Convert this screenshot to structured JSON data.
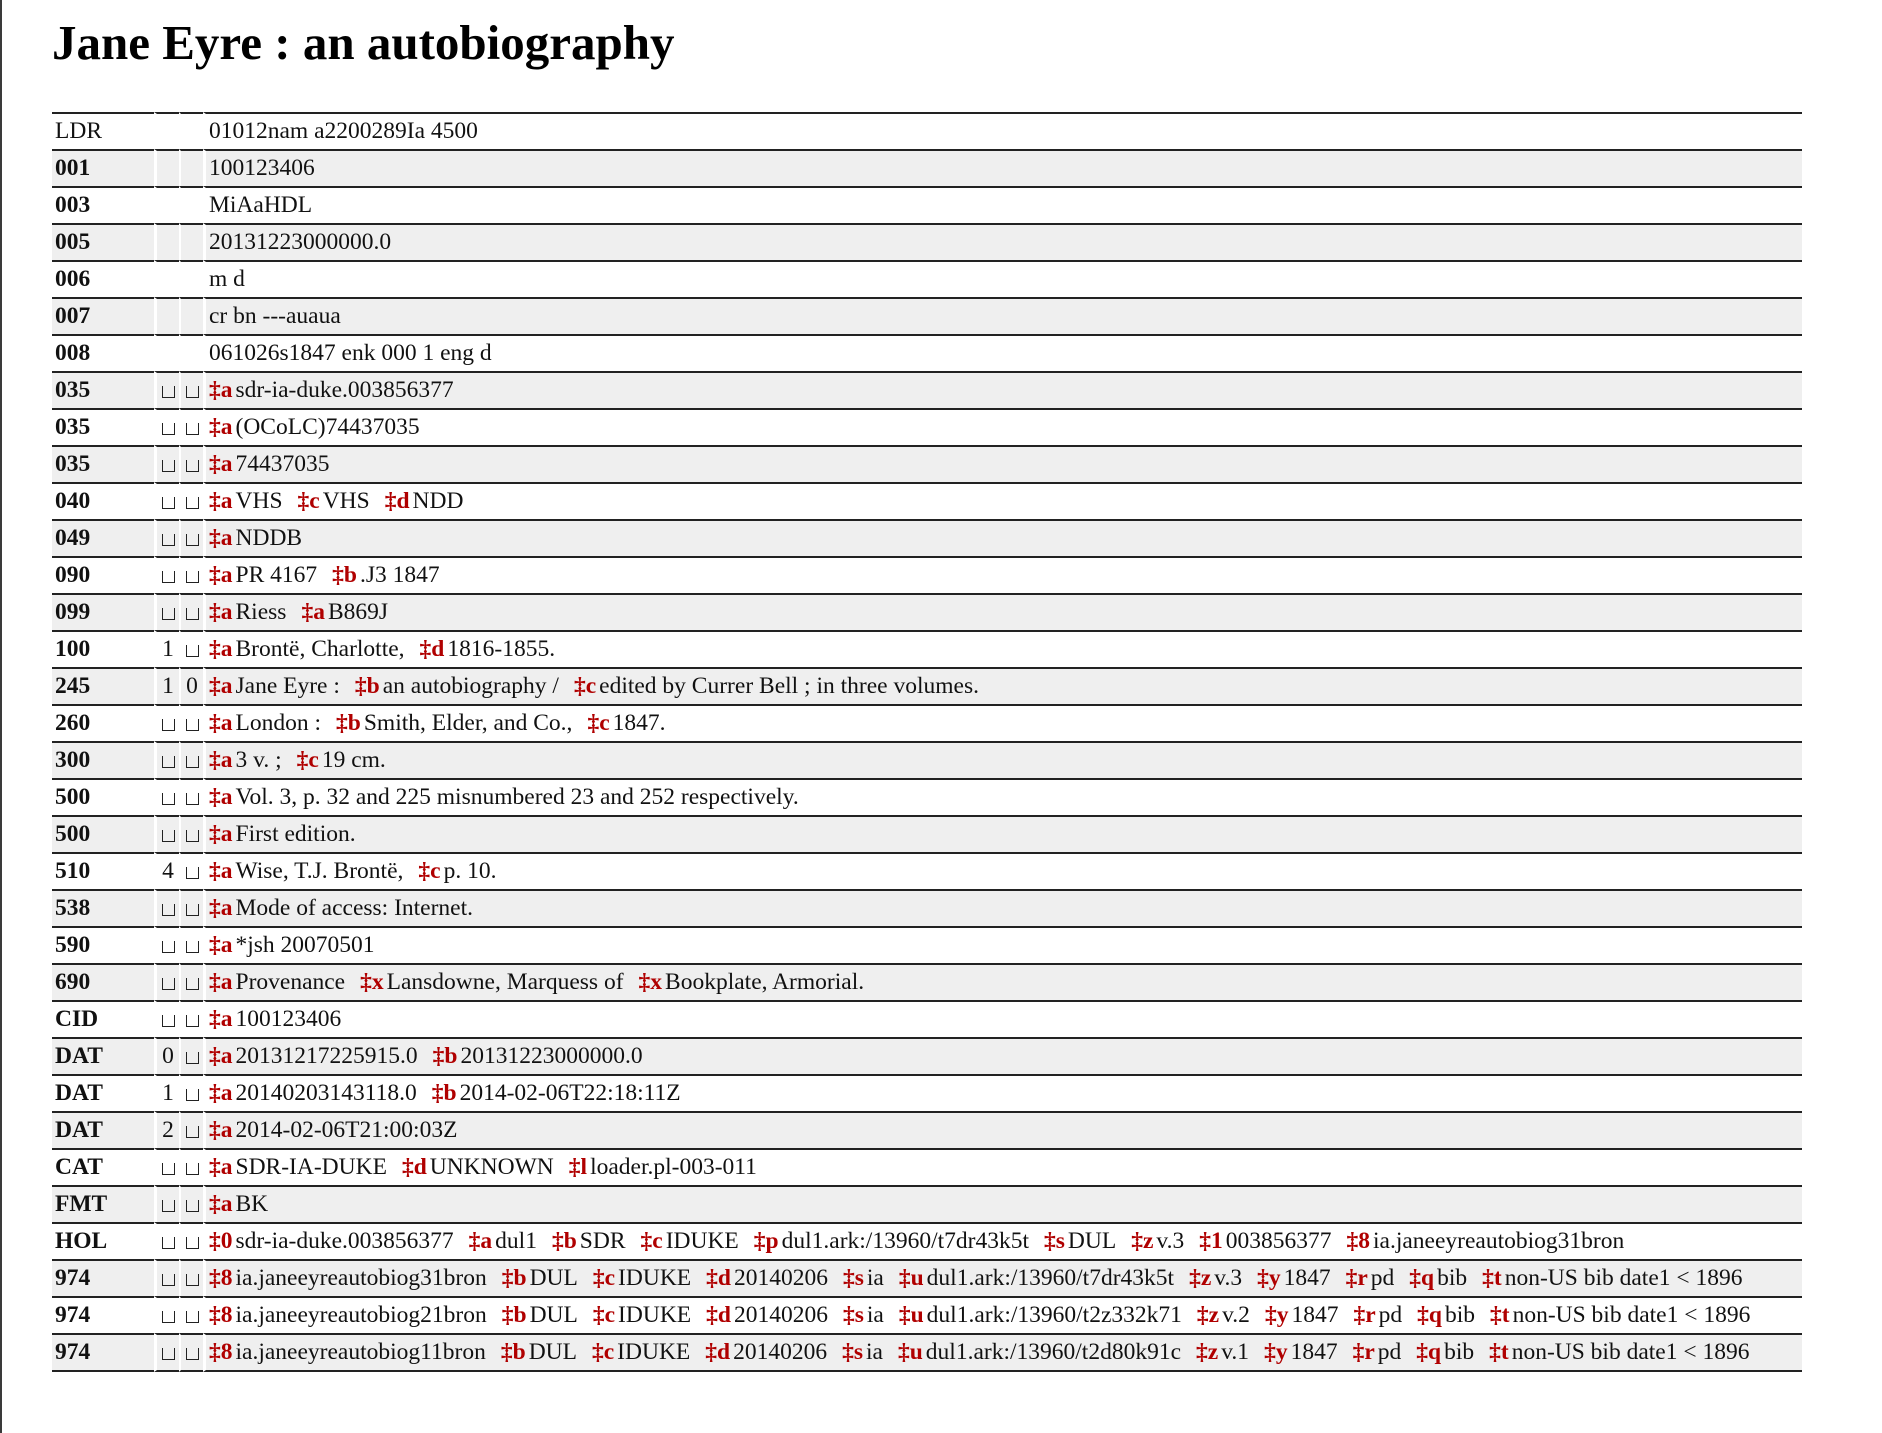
{
  "record": {
    "title": "Jane Eyre : an autobiography",
    "colors": {
      "subfield_code": "#b00000",
      "row_stripe": "#efefef",
      "rule": "#222222"
    },
    "icons": {
      "blank_indicator": "blank-indicator-icon"
    },
    "fields": [
      {
        "tag": "LDR",
        "value": "01012nam a2200289Ia 4500"
      },
      {
        "tag": "001",
        "value": "100123406"
      },
      {
        "tag": "003",
        "value": "MiAaHDL"
      },
      {
        "tag": "005",
        "value": "20131223000000.0"
      },
      {
        "tag": "006",
        "value": "m d"
      },
      {
        "tag": "007",
        "value": "cr bn ---auaua"
      },
      {
        "tag": "008",
        "value": "061026s1847 enk 000 1 eng d"
      },
      {
        "tag": "035",
        "ind1": "",
        "ind2": "",
        "subfields": [
          {
            "code": "‡a",
            "text": "sdr-ia-duke.003856377"
          }
        ]
      },
      {
        "tag": "035",
        "ind1": "",
        "ind2": "",
        "subfields": [
          {
            "code": "‡a",
            "text": "(OCoLC)74437035"
          }
        ]
      },
      {
        "tag": "035",
        "ind1": "",
        "ind2": "",
        "subfields": [
          {
            "code": "‡a",
            "text": "74437035"
          }
        ]
      },
      {
        "tag": "040",
        "ind1": "",
        "ind2": "",
        "subfields": [
          {
            "code": "‡a",
            "text": "VHS"
          },
          {
            "code": "‡c",
            "text": "VHS"
          },
          {
            "code": "‡d",
            "text": "NDD"
          }
        ]
      },
      {
        "tag": "049",
        "ind1": "",
        "ind2": "",
        "subfields": [
          {
            "code": "‡a",
            "text": "NDDB"
          }
        ]
      },
      {
        "tag": "090",
        "ind1": "",
        "ind2": "",
        "subfields": [
          {
            "code": "‡a",
            "text": "PR 4167"
          },
          {
            "code": "‡b",
            "text": ".J3 1847"
          }
        ]
      },
      {
        "tag": "099",
        "ind1": "",
        "ind2": "",
        "subfields": [
          {
            "code": "‡a",
            "text": "Riess"
          },
          {
            "code": "‡a",
            "text": "B869J"
          }
        ]
      },
      {
        "tag": "100",
        "ind1": "1",
        "ind2": "",
        "subfields": [
          {
            "code": "‡a",
            "text": "Brontë, Charlotte,"
          },
          {
            "code": "‡d",
            "text": "1816-1855."
          }
        ]
      },
      {
        "tag": "245",
        "ind1": "1",
        "ind2": "0",
        "subfields": [
          {
            "code": "‡a",
            "text": "Jane Eyre :"
          },
          {
            "code": "‡b",
            "text": "an autobiography /"
          },
          {
            "code": "‡c",
            "text": "edited by Currer Bell ; in three volumes."
          }
        ]
      },
      {
        "tag": "260",
        "ind1": "",
        "ind2": "",
        "subfields": [
          {
            "code": "‡a",
            "text": "London :"
          },
          {
            "code": "‡b",
            "text": "Smith, Elder, and Co.,"
          },
          {
            "code": "‡c",
            "text": "1847."
          }
        ]
      },
      {
        "tag": "300",
        "ind1": "",
        "ind2": "",
        "subfields": [
          {
            "code": "‡a",
            "text": "3 v. ;"
          },
          {
            "code": "‡c",
            "text": "19 cm."
          }
        ]
      },
      {
        "tag": "500",
        "ind1": "",
        "ind2": "",
        "subfields": [
          {
            "code": "‡a",
            "text": "Vol. 3, p. 32 and 225 misnumbered 23 and 252 respectively."
          }
        ]
      },
      {
        "tag": "500",
        "ind1": "",
        "ind2": "",
        "subfields": [
          {
            "code": "‡a",
            "text": "First edition."
          }
        ]
      },
      {
        "tag": "510",
        "ind1": "4",
        "ind2": "",
        "subfields": [
          {
            "code": "‡a",
            "text": "Wise, T.J. Brontë,"
          },
          {
            "code": "‡c",
            "text": "p. 10."
          }
        ]
      },
      {
        "tag": "538",
        "ind1": "",
        "ind2": "",
        "subfields": [
          {
            "code": "‡a",
            "text": "Mode of access: Internet."
          }
        ]
      },
      {
        "tag": "590",
        "ind1": "",
        "ind2": "",
        "subfields": [
          {
            "code": "‡a",
            "text": "*jsh 20070501"
          }
        ]
      },
      {
        "tag": "690",
        "ind1": "",
        "ind2": "",
        "subfields": [
          {
            "code": "‡a",
            "text": "Provenance"
          },
          {
            "code": "‡x",
            "text": "Lansdowne, Marquess of"
          },
          {
            "code": "‡x",
            "text": "Bookplate, Armorial."
          }
        ]
      },
      {
        "tag": "CID",
        "ind1": "",
        "ind2": "",
        "subfields": [
          {
            "code": "‡a",
            "text": "100123406"
          }
        ]
      },
      {
        "tag": "DAT",
        "ind1": "0",
        "ind2": "",
        "subfields": [
          {
            "code": "‡a",
            "text": "20131217225915.0"
          },
          {
            "code": "‡b",
            "text": "20131223000000.0"
          }
        ]
      },
      {
        "tag": "DAT",
        "ind1": "1",
        "ind2": "",
        "subfields": [
          {
            "code": "‡a",
            "text": "20140203143118.0"
          },
          {
            "code": "‡b",
            "text": "2014-02-06T22:18:11Z"
          }
        ]
      },
      {
        "tag": "DAT",
        "ind1": "2",
        "ind2": "",
        "subfields": [
          {
            "code": "‡a",
            "text": "2014-02-06T21:00:03Z"
          }
        ]
      },
      {
        "tag": "CAT",
        "ind1": "",
        "ind2": "",
        "subfields": [
          {
            "code": "‡a",
            "text": "SDR-IA-DUKE"
          },
          {
            "code": "‡d",
            "text": "UNKNOWN"
          },
          {
            "code": "‡l",
            "text": "loader.pl-003-011"
          }
        ]
      },
      {
        "tag": "FMT",
        "ind1": "",
        "ind2": "",
        "subfields": [
          {
            "code": "‡a",
            "text": "BK"
          }
        ]
      },
      {
        "tag": "HOL",
        "ind1": "",
        "ind2": "",
        "subfields": [
          {
            "code": "‡0",
            "text": "sdr-ia-duke.003856377"
          },
          {
            "code": "‡a",
            "text": "dul1"
          },
          {
            "code": "‡b",
            "text": "SDR"
          },
          {
            "code": "‡c",
            "text": "IDUKE"
          },
          {
            "code": "‡p",
            "text": "dul1.ark:/13960/t7dr43k5t"
          },
          {
            "code": "‡s",
            "text": "DUL"
          },
          {
            "code": "‡z",
            "text": "v.3"
          },
          {
            "code": "‡1",
            "text": "003856377"
          },
          {
            "code": "‡8",
            "text": "ia.janeeyreautobiog31bron"
          }
        ]
      },
      {
        "tag": "974",
        "ind1": "",
        "ind2": "",
        "subfields": [
          {
            "code": "‡8",
            "text": "ia.janeeyreautobiog31bron"
          },
          {
            "code": "‡b",
            "text": "DUL"
          },
          {
            "code": "‡c",
            "text": "IDUKE"
          },
          {
            "code": "‡d",
            "text": "20140206"
          },
          {
            "code": "‡s",
            "text": "ia"
          },
          {
            "code": "‡u",
            "text": "dul1.ark:/13960/t7dr43k5t"
          },
          {
            "code": "‡z",
            "text": "v.3"
          },
          {
            "code": "‡y",
            "text": "1847"
          },
          {
            "code": "‡r",
            "text": "pd"
          },
          {
            "code": "‡q",
            "text": "bib"
          },
          {
            "code": "‡t",
            "text": "non-US bib date1 < 1896"
          }
        ]
      },
      {
        "tag": "974",
        "ind1": "",
        "ind2": "",
        "subfields": [
          {
            "code": "‡8",
            "text": "ia.janeeyreautobiog21bron"
          },
          {
            "code": "‡b",
            "text": "DUL"
          },
          {
            "code": "‡c",
            "text": "IDUKE"
          },
          {
            "code": "‡d",
            "text": "20140206"
          },
          {
            "code": "‡s",
            "text": "ia"
          },
          {
            "code": "‡u",
            "text": "dul1.ark:/13960/t2z332k71"
          },
          {
            "code": "‡z",
            "text": "v.2"
          },
          {
            "code": "‡y",
            "text": "1847"
          },
          {
            "code": "‡r",
            "text": "pd"
          },
          {
            "code": "‡q",
            "text": "bib"
          },
          {
            "code": "‡t",
            "text": "non-US bib date1 < 1896"
          }
        ]
      },
      {
        "tag": "974",
        "ind1": "",
        "ind2": "",
        "subfields": [
          {
            "code": "‡8",
            "text": "ia.janeeyreautobiog11bron"
          },
          {
            "code": "‡b",
            "text": "DUL"
          },
          {
            "code": "‡c",
            "text": "IDUKE"
          },
          {
            "code": "‡d",
            "text": "20140206"
          },
          {
            "code": "‡s",
            "text": "ia"
          },
          {
            "code": "‡u",
            "text": "dul1.ark:/13960/t2d80k91c"
          },
          {
            "code": "‡z",
            "text": "v.1"
          },
          {
            "code": "‡y",
            "text": "1847"
          },
          {
            "code": "‡r",
            "text": "pd"
          },
          {
            "code": "‡q",
            "text": "bib"
          },
          {
            "code": "‡t",
            "text": "non-US bib date1 < 1896"
          }
        ]
      }
    ]
  }
}
